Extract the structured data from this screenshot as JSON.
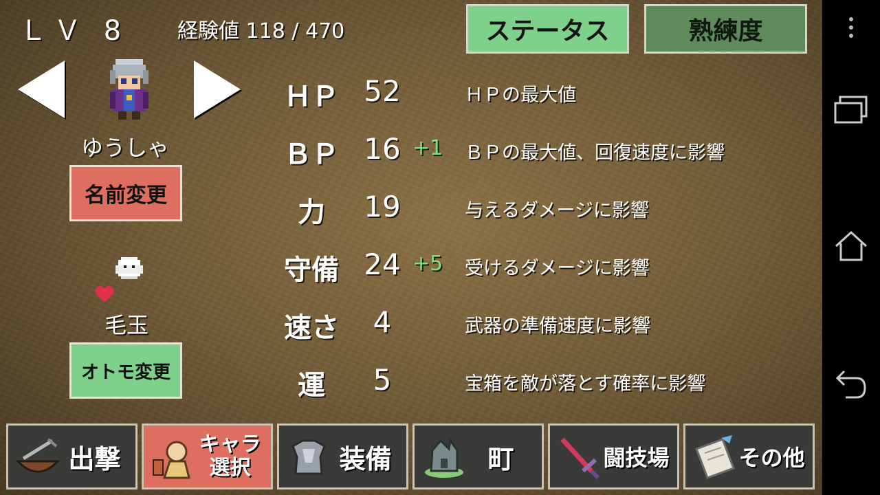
{
  "header": {
    "level_label": "ＬＶ 8",
    "exp_label": "経験値",
    "exp_value": "118 / 470",
    "tab_status": "ステータス",
    "tab_mastery": "熟練度"
  },
  "character": {
    "name": "ゆうしゃ",
    "rename_button": "名前変更"
  },
  "companion": {
    "name": "毛玉",
    "change_button": "オトモ変更"
  },
  "stats": [
    {
      "name": "ＨＰ",
      "value": "52",
      "bonus": "",
      "desc": "ＨＰの最大値"
    },
    {
      "name": "ＢＰ",
      "value": "16",
      "bonus": "+1",
      "desc": "ＢＰの最大値、回復速度に影響"
    },
    {
      "name": "力",
      "value": "19",
      "bonus": "",
      "desc": "与えるダメージに影響"
    },
    {
      "name": "守備",
      "value": "24",
      "bonus": "+5",
      "desc": "受けるダメージに影響"
    },
    {
      "name": "速さ",
      "value": "4",
      "bonus": "",
      "desc": "武器の準備速度に影響"
    },
    {
      "name": "運",
      "value": "5",
      "bonus": "",
      "desc": "宝箱を敵が落とす確率に影響"
    }
  ],
  "bottom_nav": [
    {
      "label": "出撃",
      "icon": "boat-icon"
    },
    {
      "label": "キャラ\n選択",
      "icon": "character-icon",
      "active": true
    },
    {
      "label": "装備",
      "icon": "armor-icon"
    },
    {
      "label": "町",
      "icon": "town-icon"
    },
    {
      "label": "闘技場",
      "icon": "sword-icon"
    },
    {
      "label": "その他",
      "icon": "scroll-icon"
    }
  ],
  "colors": {
    "green_button": "#7fd08a",
    "red_button": "#dd6e60",
    "bonus_text": "#7ee07e"
  }
}
